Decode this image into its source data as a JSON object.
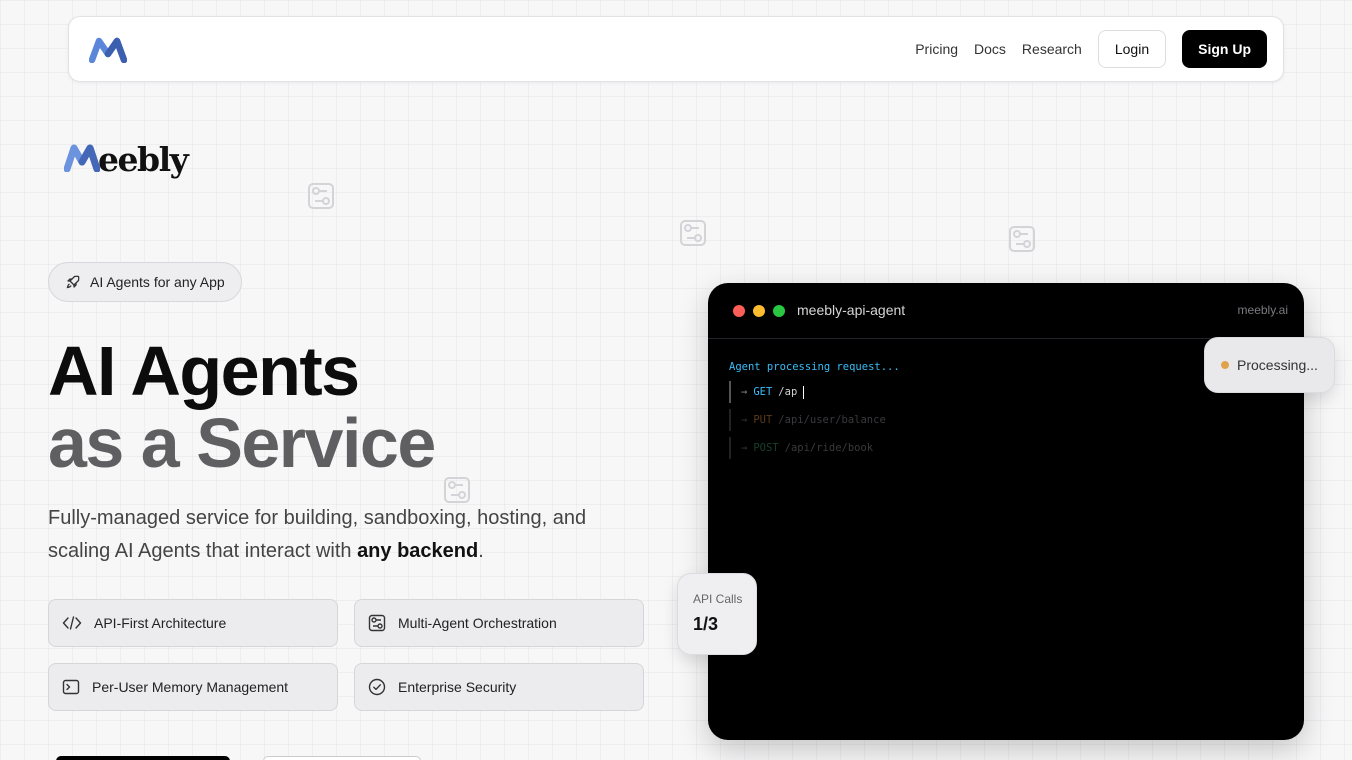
{
  "nav": {
    "links": [
      "Pricing",
      "Docs",
      "Research"
    ],
    "login_label": "Login",
    "signup_label": "Sign Up",
    "logo_icon": "meebly-m-logo"
  },
  "brand": {
    "initial": "M",
    "rest": "eebly"
  },
  "badge": {
    "label": "AI Agents for any App",
    "icon": "rocket-icon"
  },
  "hero": {
    "line1": "AI Agents",
    "line2": "as a Service",
    "desc_before": "Fully-managed service for building, sandboxing, hosting, and scaling AI Agents that interact with ",
    "desc_bold": "any backend",
    "desc_after": "."
  },
  "features": [
    {
      "label": "API-First Architecture",
      "icon": "code-icon"
    },
    {
      "label": "Multi-Agent Orchestration",
      "icon": "puzzle-icon"
    },
    {
      "label": "Per-User Memory Management",
      "icon": "terminal-icon"
    },
    {
      "label": "Enterprise Security",
      "icon": "check-circle-icon"
    }
  ],
  "terminal": {
    "title": "meebly-api-agent",
    "domain": "meebly.ai",
    "status": "Agent processing request...",
    "requests": [
      {
        "arrow": "→",
        "method": "GET",
        "path": "/ap",
        "method_color": "#38bdf8",
        "path_color": "#d4d4d4"
      },
      {
        "arrow": "→",
        "method": "PUT",
        "path": "/api/user/balance",
        "method_color": "#5a3a1a",
        "path_color": "#3a3a3e"
      },
      {
        "arrow": "→",
        "method": "POST",
        "path": "/api/ride/book",
        "method_color": "#17402a",
        "path_color": "#3a3a3e"
      }
    ],
    "dot_colors": [
      "#ff5f57",
      "#febc2e",
      "#28c840"
    ]
  },
  "processing": {
    "label": "Processing..."
  },
  "api_calls": {
    "label": "API Calls",
    "value": "1/3"
  }
}
